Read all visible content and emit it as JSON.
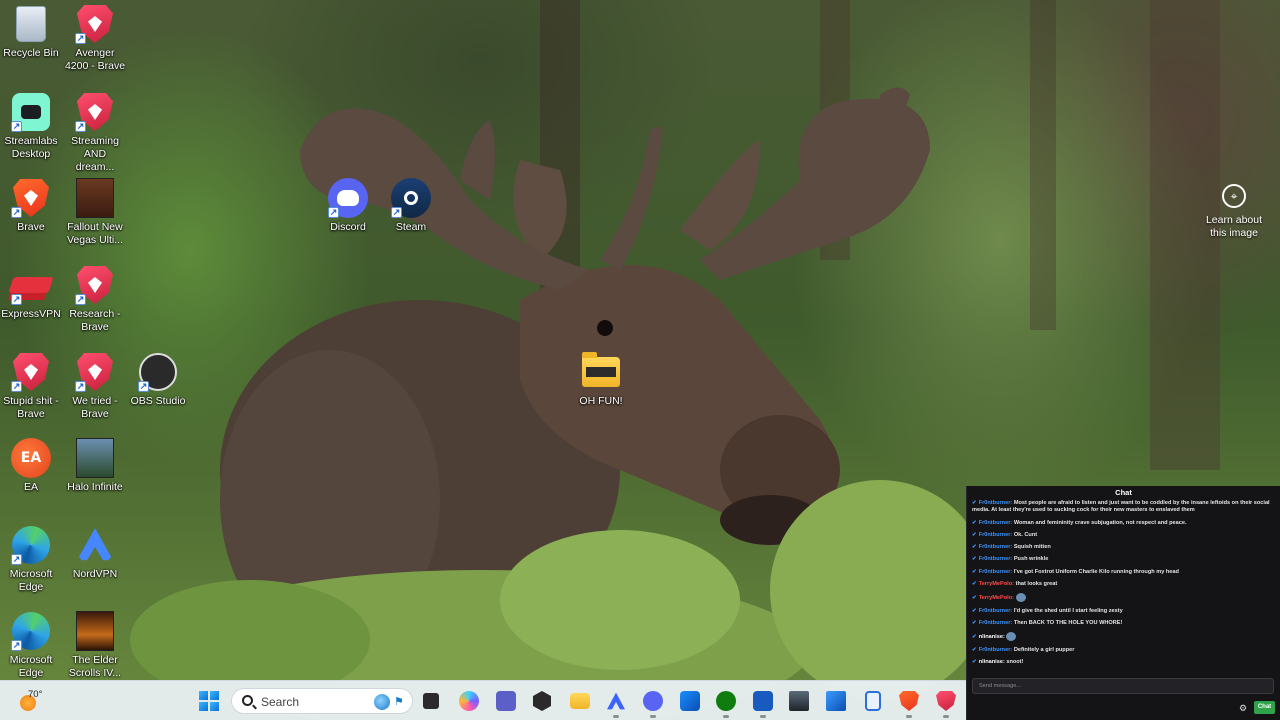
{
  "desktop": {
    "icons": [
      {
        "id": "recycle-bin",
        "label": "Recycle Bin"
      },
      {
        "id": "avenger",
        "label": "Avenger 4200 - Brave"
      },
      {
        "id": "streamlabs",
        "label": "Streamlabs Desktop"
      },
      {
        "id": "streaming",
        "label": "Streaming AND dream..."
      },
      {
        "id": "brave",
        "label": "Brave"
      },
      {
        "id": "fallout",
        "label": "Fallout New Vegas Ulti..."
      },
      {
        "id": "expressvpn",
        "label": "ExpressVPN"
      },
      {
        "id": "research",
        "label": "Research - Brave"
      },
      {
        "id": "stupid",
        "label": "Stupid shit - Brave"
      },
      {
        "id": "wetried",
        "label": "We tried - Brave"
      },
      {
        "id": "obs",
        "label": "OBS Studio"
      },
      {
        "id": "ea",
        "label": "EA"
      },
      {
        "id": "halo",
        "label": "Halo Infinite"
      },
      {
        "id": "edge1",
        "label": "Microsoft Edge"
      },
      {
        "id": "nordvpn",
        "label": "NordVPN"
      },
      {
        "id": "edge2",
        "label": "Microsoft Edge"
      },
      {
        "id": "elderscrolls",
        "label": "The Elder Scrolls IV..."
      },
      {
        "id": "discord",
        "label": "Discord"
      },
      {
        "id": "steam",
        "label": "Steam"
      },
      {
        "id": "ohfun",
        "label": "OH FUN!"
      }
    ],
    "learn_label": "Learn about this image",
    "ea_text": "EA"
  },
  "chat": {
    "title": "Chat",
    "input_placeholder": "Send message...",
    "send_label": "Chat",
    "messages": [
      {
        "user": "Fr0ntburner",
        "color": "#3f93ff",
        "text": "Most people are afraid to listen and just want to be coddled by the insane leftoids on their social media. At least they're used to sucking cock for their new masters to enslaved them"
      },
      {
        "user": "Fr0ntburner",
        "color": "#3f93ff",
        "text": "Woman and femininity crave subjugation, not respect and peace."
      },
      {
        "user": "Fr0ntburner",
        "color": "#3f93ff",
        "text": "Ok. Cunt"
      },
      {
        "user": "Fr0ntburner",
        "color": "#3f93ff",
        "text": "Squish mitten"
      },
      {
        "user": "Fr0ntburner",
        "color": "#3f93ff",
        "text": "Push wrinkle"
      },
      {
        "user": "Fr0ntburner",
        "color": "#3f93ff",
        "text": "I've got Foxtrot Uniform Charlie Kilo running through my head"
      },
      {
        "user": "TerryMePolo",
        "color": "#ff4a4a",
        "text": "that looks great"
      },
      {
        "user": "TerryMePolo",
        "color": "#ff4a4a",
        "text": "",
        "emote": true
      },
      {
        "user": "Fr0ntburner",
        "color": "#3f93ff",
        "text": "I'd give the shed until I start feeling zesty"
      },
      {
        "user": "Fr0ntburner",
        "color": "#3f93ff",
        "text": "Then BACK TO THE HOLE YOU WHORE!"
      },
      {
        "user": "nlinanise",
        "color": "#ffffff",
        "text": "",
        "emote": true
      },
      {
        "user": "Fr0ntburner",
        "color": "#3f93ff",
        "text": "Definitely a girl pupper"
      },
      {
        "user": "nlinanise",
        "color": "#ffffff",
        "text": "snoot!"
      }
    ]
  },
  "taskbar": {
    "weather_temp": "70°",
    "search_label": "Search",
    "apps": [
      "windows-start",
      "search",
      "task-view",
      "copilot",
      "teams",
      "app-hex",
      "file-explorer",
      "arc-browser",
      "discord",
      "microsoft-store",
      "xbox",
      "word",
      "game-app",
      "azure-app",
      "notepad",
      "brave",
      "brave-alt"
    ]
  }
}
